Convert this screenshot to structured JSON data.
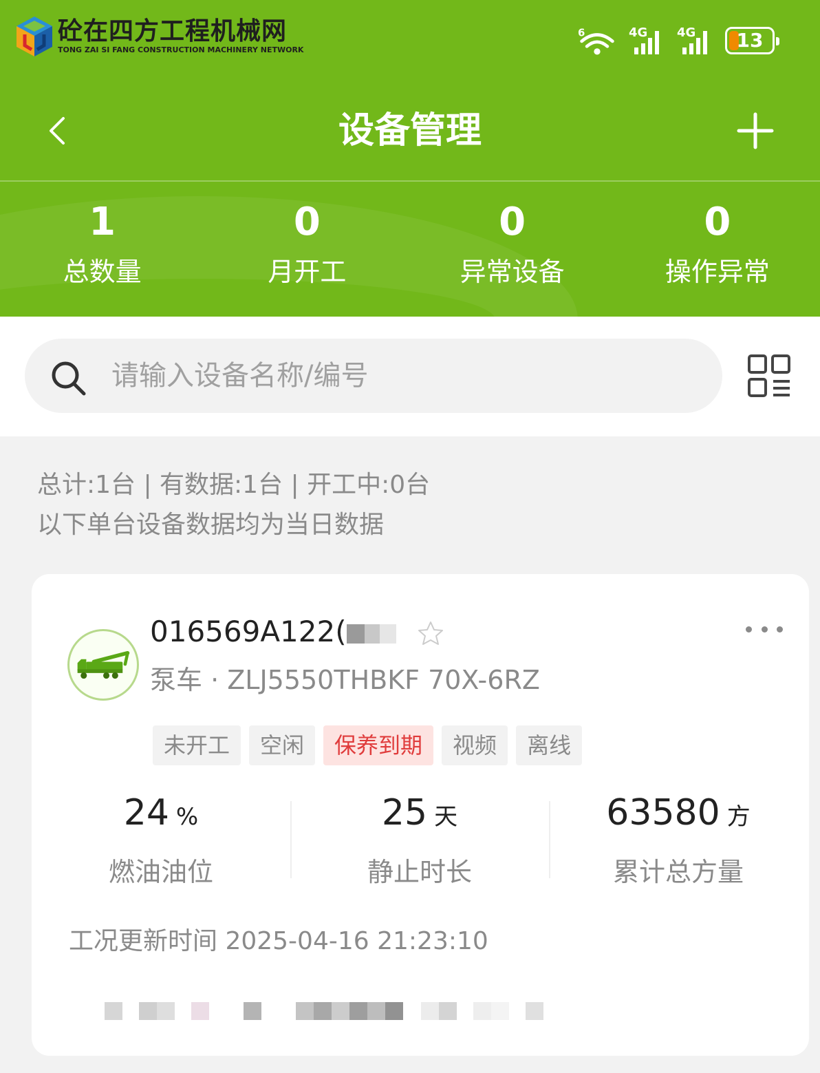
{
  "watermark": {
    "cn": "砼在四方工程机械网",
    "en": "TONG ZAI SI FANG CONSTRUCTION MACHINERY NETWORK"
  },
  "status_bar": {
    "wifi_label": "6",
    "signal1_label": "4G",
    "signal2_label": "4G",
    "battery": "13",
    "battery_color": "#f08a00"
  },
  "header": {
    "title": "设备管理",
    "back_icon": "chevron-left-icon",
    "add_icon": "plus-icon",
    "bg_color": "#72b81a"
  },
  "stats": [
    {
      "value": "1",
      "label": "总数量"
    },
    {
      "value": "0",
      "label": "月开工"
    },
    {
      "value": "0",
      "label": "异常设备"
    },
    {
      "value": "0",
      "label": "操作异常"
    }
  ],
  "search": {
    "placeholder": "请输入设备名称/编号",
    "value": ""
  },
  "summary": {
    "line1": "总计:1台 | 有数据:1台 | 开工中:0台",
    "line2": "以下单台设备数据均为当日数据"
  },
  "device": {
    "id": "016569A122(",
    "type_model": "泵车 · ZLJ5550THBKF 70X-6RZ",
    "avatar_icon": "pump-truck-icon",
    "tags": [
      {
        "label": "未开工",
        "danger": false
      },
      {
        "label": "空闲",
        "danger": false
      },
      {
        "label": "保养到期",
        "danger": true
      },
      {
        "label": "视频",
        "danger": false
      },
      {
        "label": "离线",
        "danger": false
      }
    ],
    "metrics": [
      {
        "value": "24",
        "unit": "%",
        "label": "燃油油位"
      },
      {
        "value": "25",
        "unit": "天",
        "label": "静止时长"
      },
      {
        "value": "63580",
        "unit": "方",
        "label": "累计总方量"
      }
    ],
    "update_time": "工况更新时间 2025-04-16 21:23:10",
    "danger_color": "#e03c3c"
  }
}
